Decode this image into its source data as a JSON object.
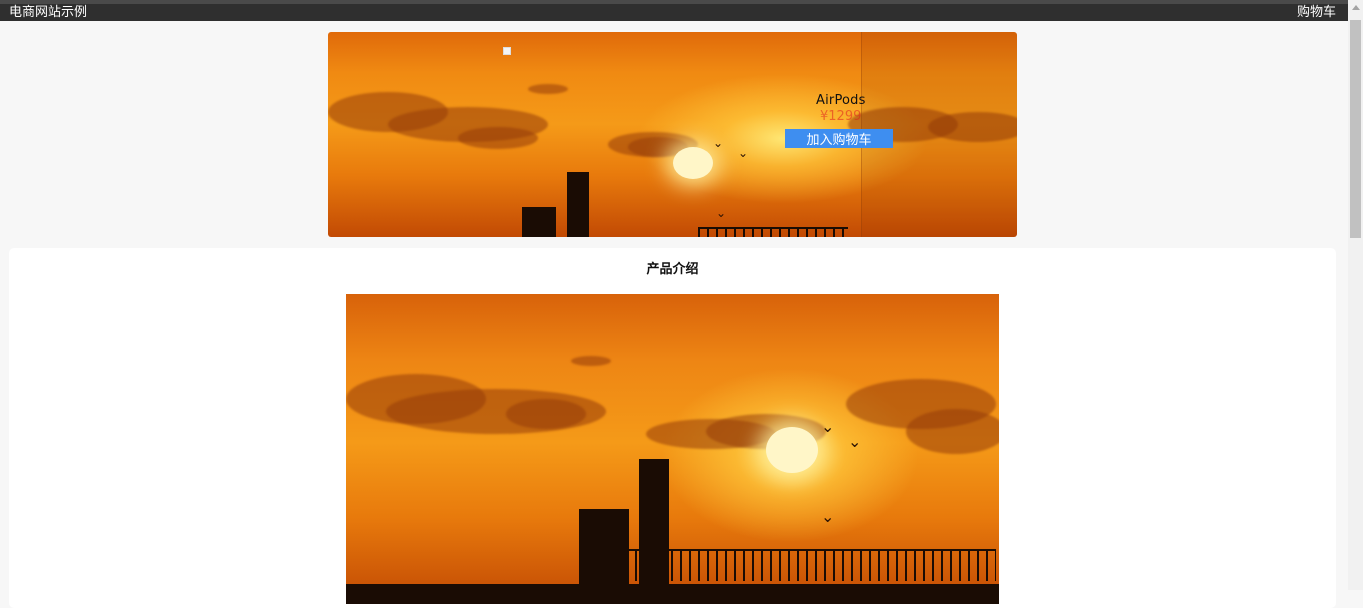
{
  "header": {
    "site_title": "电商网站示例",
    "cart_link": "购物车"
  },
  "banner": {
    "product_name": "AirPods",
    "product_price": "¥1299",
    "add_to_cart_label": "加入购物车"
  },
  "intro": {
    "section_title": "产品介绍"
  },
  "colors": {
    "header_bg": "#2f2f2f",
    "button_bg": "#3e8ef0",
    "price_color": "#e02020",
    "page_bg": "#f7f7f7"
  }
}
